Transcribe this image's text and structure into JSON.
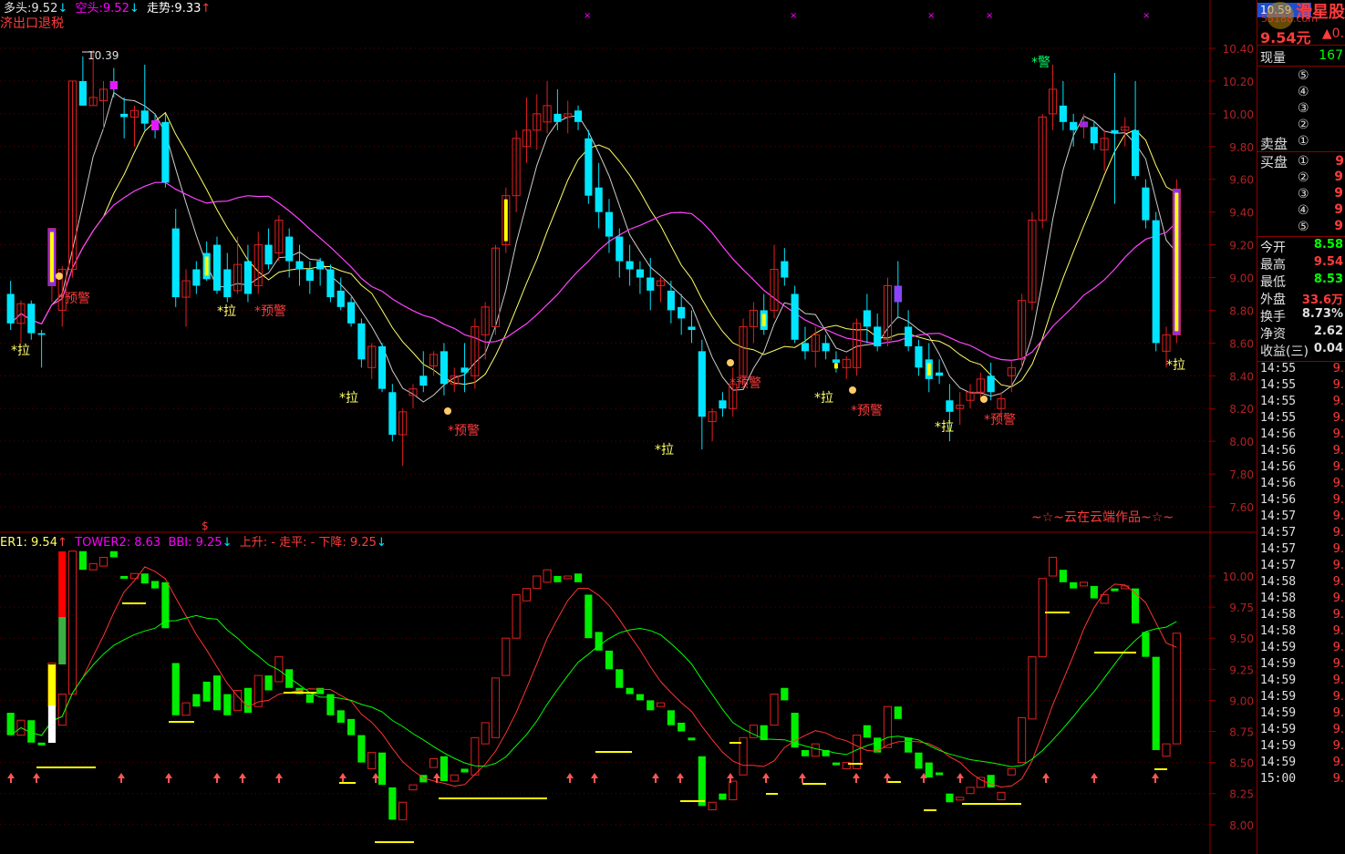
{
  "header_top": {
    "duo_tou_label": "多头:",
    "duo_tou_value": "9.52",
    "duo_tou_arrow": "↓",
    "kong_tou_label": "空头:",
    "kong_tou_value": "9.52",
    "kong_tou_arrow": "↓",
    "zou_shi_label": "走势:",
    "zou_shi_value": "9.33",
    "zou_shi_arrow": "↑",
    "concept": "济出口退税"
  },
  "header_bottom": {
    "tower1": "ER1: 9.54",
    "tower1_arrow": "↑",
    "tower2": "TOWER2: 8.63",
    "bbi": "BBI: 9.25",
    "bbi_arrow": "↓",
    "trend": "上升: -  走平: -  下降: 9.25",
    "trend_arrow": "↓",
    "marker": "$"
  },
  "main_axis": [
    "10.40",
    "10.20",
    "10.00",
    "9.80",
    "9.60",
    "9.40",
    "9.20",
    "9.00",
    "8.80",
    "8.60",
    "8.40",
    "8.20",
    "8.00",
    "7.80",
    "7.60"
  ],
  "sub_axis": [
    "10.00",
    "9.75",
    "9.50",
    "9.25",
    "9.00",
    "8.75",
    "8.50",
    "8.25",
    "8.00"
  ],
  "annotations": {
    "high_mark": "10.39",
    "la": "*拉",
    "yujing": "*预警",
    "jing": "*警",
    "signature": "~☆~云在云端作品~☆~"
  },
  "watermark": {
    "badge": "10.59",
    "brand": "滑星股",
    "site": "55188.com"
  },
  "colors": {
    "bg": "#000000",
    "up": "#e02020",
    "down": "#00e5ff",
    "green": "#00ff00",
    "yellow": "#ffff00",
    "magenta": "#ff00ff",
    "purple": "#9b30ff",
    "grid": "#8b0000",
    "axis_text": "#b22222"
  },
  "sidebar": {
    "price": "9.54元",
    "change": "▲0.",
    "xianliang_label": "现量",
    "xianliang_value": "167",
    "sell_label": "卖盘",
    "buy_label": "买盘",
    "sell_orders": [
      "⑤",
      "④",
      "③",
      "②",
      "①"
    ],
    "buy_orders": [
      "①",
      "②",
      "③",
      "④",
      "⑤"
    ],
    "buy1_value": "9",
    "buy_values": [
      "9",
      "9",
      "9",
      "9"
    ],
    "stats": [
      {
        "label": "今开",
        "value": "8.58",
        "color": "#00ff00"
      },
      {
        "label": "最高",
        "value": "9.54",
        "color": "#ff3b3b"
      },
      {
        "label": "最低",
        "value": "8.53",
        "color": "#00ff00"
      },
      {
        "label": "外盘",
        "value": "33.6万",
        "color": "#ff3b3b"
      },
      {
        "label": "换手",
        "value": "8.73%",
        "color": "#e0e0e0"
      },
      {
        "label": "净资",
        "value": "2.62",
        "color": "#e0e0e0"
      },
      {
        "label": "收益(三)",
        "value": "0.04",
        "color": "#e0e0e0"
      }
    ],
    "ticks": [
      {
        "time": "14:55",
        "price": "9."
      },
      {
        "time": "14:55",
        "price": "9."
      },
      {
        "time": "14:55",
        "price": "9."
      },
      {
        "time": "14:55",
        "price": "9."
      },
      {
        "time": "14:56",
        "price": "9."
      },
      {
        "time": "14:56",
        "price": "9."
      },
      {
        "time": "14:56",
        "price": "9."
      },
      {
        "time": "14:56",
        "price": "9."
      },
      {
        "time": "14:56",
        "price": "9."
      },
      {
        "time": "14:57",
        "price": "9."
      },
      {
        "time": "14:57",
        "price": "9."
      },
      {
        "time": "14:57",
        "price": "9."
      },
      {
        "time": "14:57",
        "price": "9."
      },
      {
        "time": "14:58",
        "price": "9."
      },
      {
        "time": "14:58",
        "price": "9."
      },
      {
        "time": "14:58",
        "price": "9."
      },
      {
        "time": "14:58",
        "price": "9."
      },
      {
        "time": "14:59",
        "price": "9."
      },
      {
        "time": "14:59",
        "price": "9."
      },
      {
        "time": "14:59",
        "price": "9."
      },
      {
        "time": "14:59",
        "price": "9."
      },
      {
        "time": "14:59",
        "price": "9."
      },
      {
        "time": "14:59",
        "price": "9."
      },
      {
        "time": "14:59",
        "price": "9."
      },
      {
        "time": "14:59",
        "price": "9."
      },
      {
        "time": "15:00",
        "price": "9."
      }
    ]
  },
  "chart_data": {
    "type": "candlestick",
    "ylim": [
      7.5,
      10.5
    ],
    "sub_ylim": [
      7.85,
      10.1
    ],
    "candles": [
      [
        8.9,
        8.98,
        8.68,
        8.72
      ],
      [
        8.72,
        8.86,
        8.6,
        8.84
      ],
      [
        8.84,
        8.86,
        8.62,
        8.66
      ],
      [
        8.66,
        8.68,
        8.45,
        8.65
      ],
      [
        8.95,
        9.3,
        8.85,
        9.3
      ],
      [
        8.8,
        9.07,
        8.7,
        9.05
      ],
      [
        9.05,
        10.2,
        9.0,
        10.2
      ],
      [
        10.2,
        10.35,
        10.05,
        10.05
      ],
      [
        10.05,
        10.39,
        10.05,
        10.1
      ],
      [
        10.08,
        10.2,
        9.9,
        10.15
      ],
      [
        10.2,
        10.28,
        10.1,
        10.15
      ],
      [
        10.0,
        10.1,
        9.85,
        9.98
      ],
      [
        9.98,
        10.05,
        9.8,
        10.02
      ],
      [
        10.02,
        10.3,
        9.9,
        9.94
      ],
      [
        9.96,
        10.0,
        9.85,
        9.9
      ],
      [
        9.95,
        10.0,
        9.55,
        9.58
      ],
      [
        9.3,
        9.42,
        8.82,
        8.88
      ],
      [
        8.88,
        9.05,
        8.7,
        8.98
      ],
      [
        9.05,
        9.1,
        8.9,
        8.95
      ],
      [
        9.15,
        9.22,
        8.98,
        8.99
      ],
      [
        9.2,
        9.25,
        8.9,
        8.92
      ],
      [
        9.05,
        9.15,
        8.85,
        8.88
      ],
      [
        8.92,
        9.25,
        8.9,
        9.08
      ],
      [
        9.1,
        9.2,
        8.85,
        8.9
      ],
      [
        8.95,
        9.28,
        8.9,
        9.2
      ],
      [
        9.2,
        9.3,
        9.05,
        9.08
      ],
      [
        9.15,
        9.38,
        9.1,
        9.35
      ],
      [
        9.25,
        9.3,
        9.0,
        9.1
      ],
      [
        9.1,
        9.2,
        8.95,
        9.05
      ],
      [
        9.05,
        9.1,
        8.9,
        8.98
      ],
      [
        9.1,
        9.12,
        8.95,
        9.05
      ],
      [
        9.05,
        9.08,
        8.85,
        8.88
      ],
      [
        8.92,
        9.0,
        8.8,
        8.82
      ],
      [
        8.85,
        8.88,
        8.7,
        8.72
      ],
      [
        8.72,
        8.75,
        8.45,
        8.5
      ],
      [
        8.45,
        8.6,
        8.38,
        8.58
      ],
      [
        8.58,
        8.6,
        8.3,
        8.32
      ],
      [
        8.3,
        8.35,
        8.0,
        8.04
      ],
      [
        8.04,
        8.2,
        7.85,
        8.18
      ],
      [
        8.28,
        8.35,
        8.2,
        8.32
      ],
      [
        8.4,
        8.55,
        8.3,
        8.34
      ],
      [
        8.46,
        8.55,
        8.4,
        8.53
      ],
      [
        8.55,
        8.6,
        8.28,
        8.35
      ],
      [
        8.35,
        8.45,
        8.3,
        8.4
      ],
      [
        8.45,
        8.6,
        8.3,
        8.42
      ],
      [
        8.4,
        8.75,
        8.32,
        8.7
      ],
      [
        8.65,
        8.85,
        8.5,
        8.82
      ],
      [
        8.7,
        9.2,
        8.65,
        9.18
      ],
      [
        9.2,
        9.55,
        9.15,
        9.5
      ],
      [
        9.5,
        9.9,
        9.4,
        9.85
      ],
      [
        9.8,
        10.1,
        9.7,
        9.9
      ],
      [
        9.9,
        10.12,
        9.78,
        10.0
      ],
      [
        9.95,
        10.2,
        9.88,
        10.05
      ],
      [
        10.0,
        10.15,
        9.9,
        9.95
      ],
      [
        9.98,
        10.08,
        9.88,
        10.0
      ],
      [
        10.02,
        10.05,
        9.9,
        9.95
      ],
      [
        9.85,
        9.9,
        9.45,
        9.5
      ],
      [
        9.55,
        9.7,
        9.3,
        9.4
      ],
      [
        9.4,
        9.48,
        9.15,
        9.25
      ],
      [
        9.25,
        9.3,
        9.0,
        9.1
      ],
      [
        9.1,
        9.2,
        8.95,
        9.05
      ],
      [
        9.05,
        9.1,
        8.9,
        9.0
      ],
      [
        9.0,
        9.12,
        8.8,
        8.92
      ],
      [
        8.95,
        9.0,
        8.85,
        8.98
      ],
      [
        8.92,
        8.98,
        8.72,
        8.8
      ],
      [
        8.82,
        8.9,
        8.65,
        8.75
      ],
      [
        8.7,
        8.8,
        8.6,
        8.68
      ],
      [
        8.55,
        8.62,
        7.95,
        8.15
      ],
      [
        8.12,
        8.2,
        8.0,
        8.18
      ],
      [
        8.25,
        8.3,
        8.15,
        8.2
      ],
      [
        8.2,
        8.45,
        8.15,
        8.35
      ],
      [
        8.4,
        8.75,
        8.35,
        8.7
      ],
      [
        8.7,
        8.85,
        8.6,
        8.8
      ],
      [
        8.8,
        8.9,
        8.65,
        8.68
      ],
      [
        8.8,
        9.2,
        8.75,
        9.05
      ],
      [
        9.1,
        9.18,
        8.95,
        9.0
      ],
      [
        8.9,
        8.95,
        8.6,
        8.62
      ],
      [
        8.6,
        8.7,
        8.5,
        8.55
      ],
      [
        8.55,
        8.7,
        8.45,
        8.65
      ],
      [
        8.6,
        8.65,
        8.5,
        8.55
      ],
      [
        8.5,
        8.55,
        8.42,
        8.48
      ],
      [
        8.45,
        8.52,
        8.38,
        8.5
      ],
      [
        8.45,
        8.75,
        8.4,
        8.72
      ],
      [
        8.8,
        8.9,
        8.6,
        8.7
      ],
      [
        8.7,
        8.78,
        8.55,
        8.58
      ],
      [
        8.62,
        9.0,
        8.58,
        8.95
      ],
      [
        8.95,
        9.1,
        8.75,
        8.85
      ],
      [
        8.7,
        8.8,
        8.55,
        8.58
      ],
      [
        8.58,
        8.62,
        8.4,
        8.45
      ],
      [
        8.5,
        8.6,
        8.3,
        8.38
      ],
      [
        8.42,
        8.5,
        8.35,
        8.4
      ],
      [
        8.25,
        8.35,
        8.0,
        8.18
      ],
      [
        8.2,
        8.3,
        8.1,
        8.22
      ],
      [
        8.25,
        8.35,
        8.2,
        8.3
      ],
      [
        8.3,
        8.42,
        8.25,
        8.38
      ],
      [
        8.4,
        8.48,
        8.25,
        8.3
      ],
      [
        8.2,
        8.3,
        8.15,
        8.26
      ],
      [
        8.4,
        8.5,
        8.3,
        8.45
      ],
      [
        8.5,
        8.9,
        8.45,
        8.86
      ],
      [
        8.85,
        9.4,
        8.8,
        9.35
      ],
      [
        9.35,
        10.0,
        9.3,
        9.98
      ],
      [
        10.0,
        10.3,
        9.9,
        10.15
      ],
      [
        10.05,
        10.2,
        9.9,
        9.95
      ],
      [
        9.95,
        10.0,
        9.8,
        9.9
      ],
      [
        9.92,
        10.0,
        9.85,
        9.95
      ],
      [
        9.92,
        9.95,
        9.78,
        9.82
      ],
      [
        9.78,
        9.9,
        9.65,
        9.85
      ],
      [
        9.9,
        10.25,
        9.45,
        9.88
      ],
      [
        9.9,
        9.98,
        9.8,
        9.92
      ],
      [
        9.9,
        10.2,
        9.6,
        9.62
      ],
      [
        9.55,
        9.6,
        9.3,
        9.35
      ],
      [
        9.35,
        9.4,
        8.55,
        8.6
      ],
      [
        8.55,
        8.7,
        8.45,
        8.65
      ],
      [
        8.65,
        9.6,
        8.6,
        9.54
      ]
    ]
  }
}
